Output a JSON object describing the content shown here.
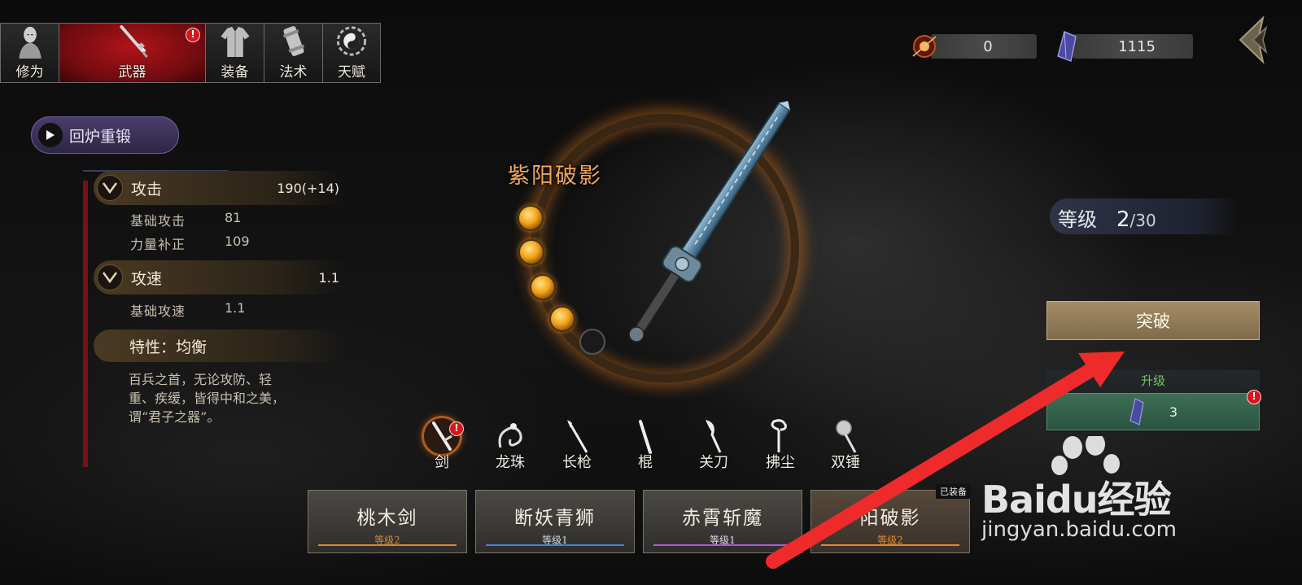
{
  "tabs": [
    {
      "label": "修为",
      "icon": "cultivation-figure-icon"
    },
    {
      "label": "武器",
      "icon": "sword-icon",
      "alert": "!"
    },
    {
      "label": "装备",
      "icon": "robe-icon"
    },
    {
      "label": "法术",
      "icon": "scroll-icon"
    },
    {
      "label": "天赋",
      "icon": "yin-yang-icon"
    }
  ],
  "currencies": {
    "ember": {
      "value": "0",
      "icon": "ember-orb-icon"
    },
    "crystal": {
      "value": "1115",
      "icon": "purple-crystal-icon"
    }
  },
  "reforge_label": "回炉重锻",
  "stats": {
    "attack": {
      "name": "攻击",
      "value": "190(+14)",
      "subs": [
        {
          "k": "基础攻击",
          "v": "81"
        },
        {
          "k": "力量补正",
          "v": "109"
        }
      ]
    },
    "speed": {
      "name": "攻速",
      "value": "1.1",
      "subs": [
        {
          "k": "基础攻速",
          "v": "1.1"
        }
      ]
    },
    "trait": "特性：均衡",
    "description": "百兵之首，无论攻防、轻重、疾缓，皆得中和之美，谓“君子之器”。"
  },
  "weapon": {
    "name": "紫阳破影",
    "orbs_filled": 4,
    "orbs_total": 5
  },
  "level": {
    "label": "等级",
    "current": "2",
    "max": "/30"
  },
  "breakthrough_label": "突破",
  "upgrade": {
    "title": "升级",
    "cost": "3",
    "alert": "!"
  },
  "weapon_types": [
    {
      "label": "剑",
      "icon": "sword-type-icon",
      "selected": true,
      "alert": "!"
    },
    {
      "label": "龙珠",
      "icon": "dragon-orb-icon"
    },
    {
      "label": "长枪",
      "icon": "spear-icon"
    },
    {
      "label": "棍",
      "icon": "staff-icon"
    },
    {
      "label": "关刀",
      "icon": "guandao-icon"
    },
    {
      "label": "拂尘",
      "icon": "whisk-icon"
    },
    {
      "label": "双锤",
      "icon": "twin-hammer-icon"
    }
  ],
  "weapon_cards": [
    {
      "name": "桃木剑",
      "level": "等级2",
      "accent": "#d08a3a"
    },
    {
      "name": "断妖青狮",
      "level": "等级1",
      "accent": "#4d7ec9"
    },
    {
      "name": "赤霄斩魔",
      "level": "等级1",
      "accent": "#a060d0"
    },
    {
      "name": "阳破影",
      "level": "等级2",
      "accent": "#e08a30",
      "tag": "已装备"
    }
  ],
  "colors": {
    "accent_red": "#b0141a",
    "gold": "#f0a75a",
    "green": "#73c25e",
    "arrow": "#ef2a2a"
  },
  "watermark": {
    "line1": "Baidu经验",
    "line2": "jingyan.baidu.com"
  }
}
